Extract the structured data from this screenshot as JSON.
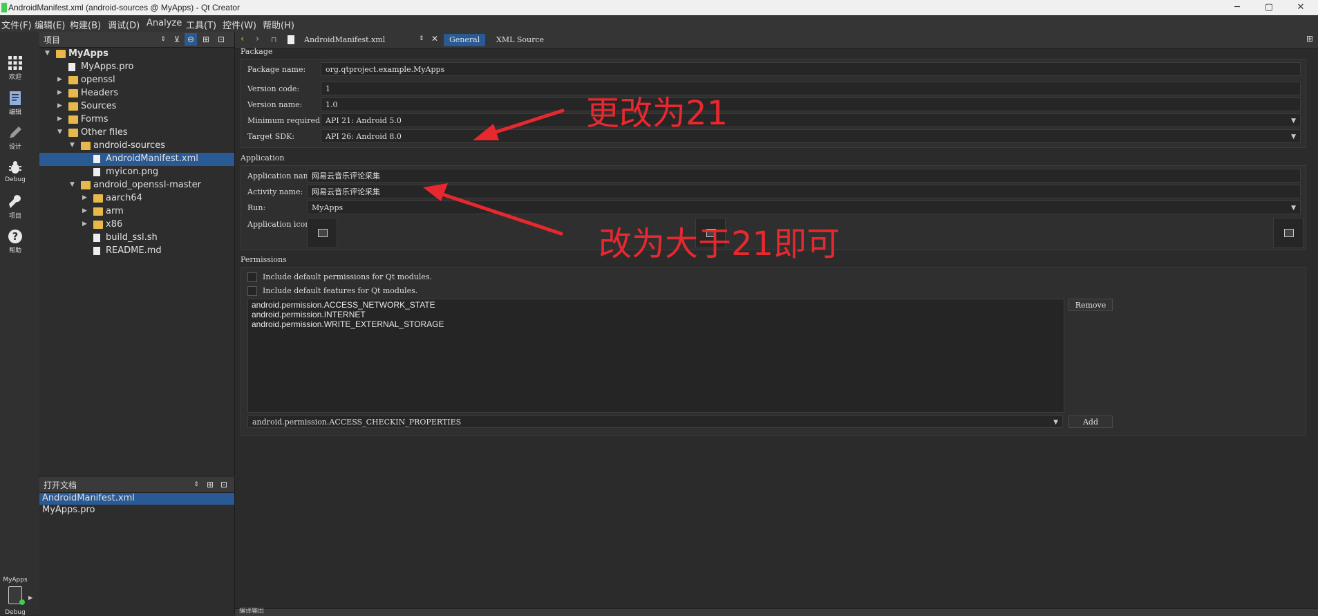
{
  "window": {
    "title": "AndroidManifest.xml (android-sources @ MyApps) - Qt Creator",
    "min_glyph": "─",
    "max_glyph": "▢",
    "close_glyph": "✕"
  },
  "menu": [
    "文件(F)",
    "编辑(E)",
    "构建(B)",
    "调试(D)",
    "Analyze",
    "工具(T)",
    "控件(W)",
    "帮助(H)"
  ],
  "modes": [
    {
      "label": "欢迎",
      "icon": "grid-icon"
    },
    {
      "label": "编辑",
      "icon": "edit-document-icon"
    },
    {
      "label": "设计",
      "icon": "pencil-icon"
    },
    {
      "label": "Debug",
      "icon": "bug-icon"
    },
    {
      "label": "项目",
      "icon": "wrench-icon"
    },
    {
      "label": "帮助",
      "icon": "help-icon"
    }
  ],
  "kit": {
    "project": "MyApps",
    "mode": "Debug"
  },
  "project_panel": {
    "title": "项目",
    "tree": [
      {
        "label": "MyApps",
        "level": 0,
        "kind": "project",
        "expanded": true,
        "bold": true
      },
      {
        "label": "MyApps.pro",
        "level": 1,
        "kind": "file"
      },
      {
        "label": "openssl",
        "level": 1,
        "kind": "folder",
        "expanded": false
      },
      {
        "label": "Headers",
        "level": 1,
        "kind": "folder",
        "expanded": false
      },
      {
        "label": "Sources",
        "level": 1,
        "kind": "folder",
        "expanded": false
      },
      {
        "label": "Forms",
        "level": 1,
        "kind": "folder",
        "expanded": false
      },
      {
        "label": "Other files",
        "level": 1,
        "kind": "folder",
        "expanded": true
      },
      {
        "label": "android-sources",
        "level": 2,
        "kind": "folder",
        "expanded": true
      },
      {
        "label": "AndroidManifest.xml",
        "level": 3,
        "kind": "file",
        "selected": true
      },
      {
        "label": "myicon.png",
        "level": 3,
        "kind": "file"
      },
      {
        "label": "android_openssl-master",
        "level": 2,
        "kind": "folder",
        "expanded": true
      },
      {
        "label": "aarch64",
        "level": 3,
        "kind": "folder",
        "expanded": false
      },
      {
        "label": "arm",
        "level": 3,
        "kind": "folder",
        "expanded": false
      },
      {
        "label": "x86",
        "level": 3,
        "kind": "folder",
        "expanded": false
      },
      {
        "label": "build_ssl.sh",
        "level": 3,
        "kind": "file"
      },
      {
        "label": "README.md",
        "level": 3,
        "kind": "file"
      }
    ]
  },
  "open_docs": {
    "title": "打开文档",
    "items": [
      {
        "label": "AndroidManifest.xml",
        "selected": true
      },
      {
        "label": "MyApps.pro",
        "selected": false
      }
    ]
  },
  "editor": {
    "file": "AndroidManifest.xml",
    "tabs": [
      {
        "label": "General",
        "active": true
      },
      {
        "label": "XML Source",
        "active": false
      }
    ]
  },
  "package": {
    "title": "Package",
    "package_name_label": "Package name:",
    "package_name": "org.qtproject.example.MyApps",
    "version_code_label": "Version code:",
    "version_code": "1",
    "version_name_label": "Version name:",
    "version_name": "1.0",
    "min_sdk_label": "Minimum required SDK:",
    "min_sdk": "API 21: Android 5.0",
    "target_sdk_label": "Target SDK:",
    "target_sdk": "API 26: Android 8.0"
  },
  "application": {
    "title": "Application",
    "app_name_label": "Application name:",
    "app_name": "网易云音乐评论采集",
    "activity_name_label": "Activity name:",
    "activity_name": "网易云音乐评论采集",
    "run_label": "Run:",
    "run": "MyApps",
    "icon_label": "Application icon:"
  },
  "permissions": {
    "title": "Permissions",
    "include_perms": "Include default permissions for Qt modules.",
    "include_features": "Include default features for Qt modules.",
    "list": [
      "android.permission.ACCESS_NETWORK_STATE",
      "android.permission.INTERNET",
      "android.permission.WRITE_EXTERNAL_STORAGE"
    ],
    "remove_label": "Remove",
    "add_combo": "android.permission.ACCESS_CHECKIN_PROPERTIES",
    "add_label": "Add"
  },
  "annotations": {
    "a1": "更改为21",
    "a2": "改为大于21即可",
    "color": "#e8282f"
  },
  "bottom": {
    "label": "编译输出"
  }
}
